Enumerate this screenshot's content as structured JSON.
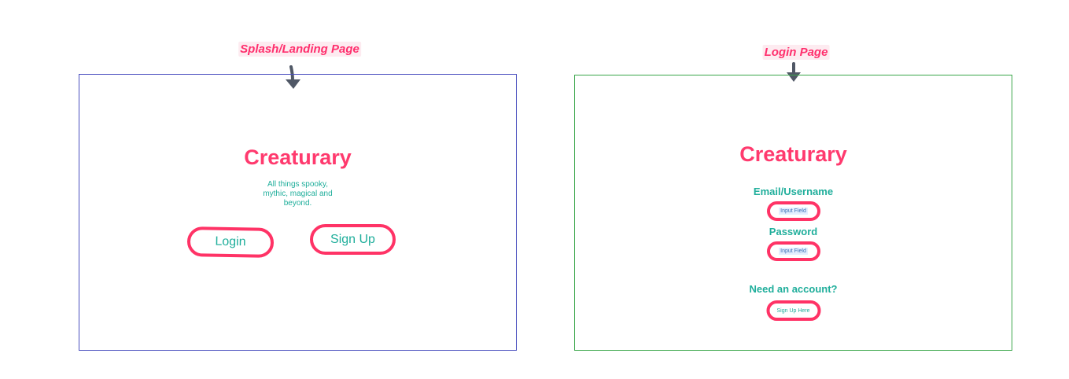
{
  "labels": {
    "splash": "Splash/Landing Page",
    "login": "Login Page"
  },
  "splash": {
    "title": "Creaturary",
    "tagline": "All things spooky, mythic, magical and beyond.",
    "login_button": "Login",
    "signup_button": "Sign Up"
  },
  "login": {
    "title": "Creaturary",
    "email_label": "Email/Username",
    "email_input": "Input Field",
    "password_label": "Password",
    "password_input": "Input Field",
    "account_prompt": "Need an account?",
    "signup_here": "Sign Up Here"
  },
  "colors": {
    "brand_pink": "#ff3366",
    "text_teal": "#1fae9b",
    "splash_frame": "#4a4fbf",
    "login_frame": "#3aa64a",
    "arrow": "#505866"
  }
}
